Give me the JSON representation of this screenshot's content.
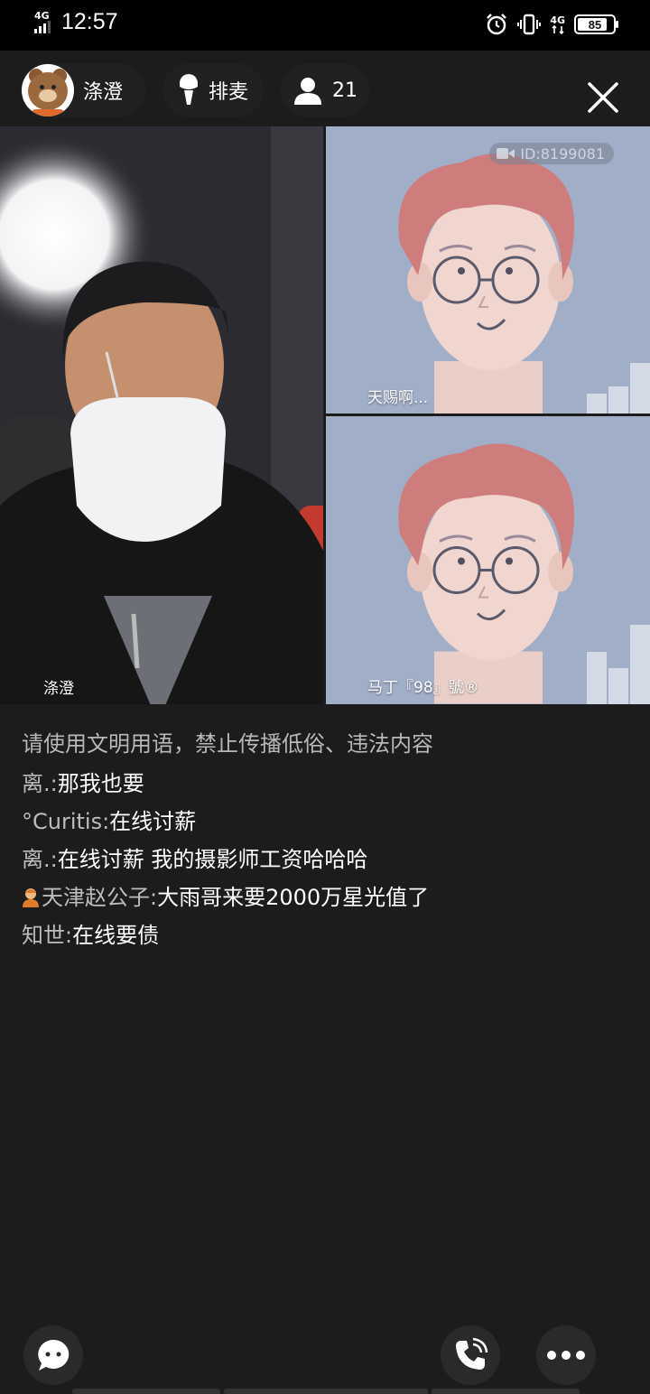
{
  "status_bar": {
    "network_left": "4G",
    "time": "12:57",
    "network_right": "4G",
    "battery": "85",
    "battery_level": 0.85
  },
  "header": {
    "host_name": "涤澄",
    "queue_label": "排麦",
    "viewer_count": "21"
  },
  "video": {
    "main_label": "涤澄",
    "guest_a_label": "天赐啊...",
    "guest_b_label": "马丁『98』號®",
    "room_id": "ID:8199081"
  },
  "chat": {
    "notice": "请使用文明用语，禁止传播低俗、违法内容",
    "messages": [
      {
        "sender": "离.:",
        "text": "那我也要"
      },
      {
        "sender": "°Curitis:",
        "text": "在线讨薪"
      },
      {
        "sender": "离.:",
        "text": "在线讨薪 我的摄影师工资哈哈哈"
      },
      {
        "sender": "天津赵公子:",
        "text": "大雨哥来要2000万星光值了"
      },
      {
        "sender": "知世:",
        "text": "在线要债"
      }
    ]
  },
  "icons": {
    "mic": "microphone-icon",
    "person": "person-icon",
    "close": "close-icon",
    "chat": "chat-bubble-icon",
    "call": "phone-icon",
    "more": "more-dots-icon"
  },
  "colors": {
    "background": "#1c1c1c",
    "avatar_bg": "#a0aec8",
    "hair": "#cf7c7c",
    "skin": "#f0d6cf"
  }
}
